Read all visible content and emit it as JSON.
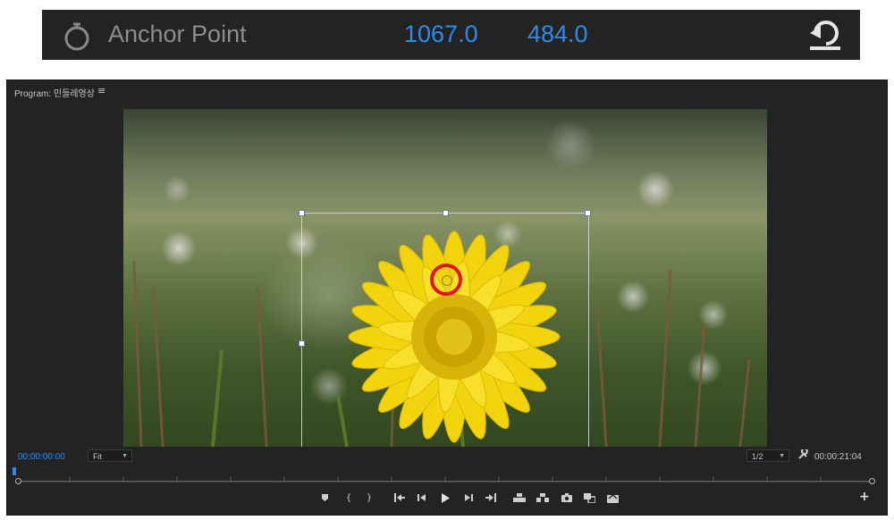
{
  "anchor_point": {
    "label": "Anchor Point",
    "x_value": "1067.0",
    "y_value": "484.0",
    "stopwatch_icon": "stopwatch-icon",
    "reset_icon": "reset-icon",
    "value_color": "#2d8ceb"
  },
  "program_monitor": {
    "title": "Program: 민들레영상",
    "menu_icon": "≡",
    "current_timecode": "00:00:00:00",
    "duration_timecode": "00:00:21:04",
    "zoom_level": "Fit",
    "playback_resolution": "1/2",
    "accent_color": "#2d8ceb",
    "anchor_marker_color": "#e1141c",
    "transport_icons": [
      "add-marker-icon",
      "mark-in-icon",
      "mark-out-icon",
      "go-to-in-icon",
      "step-back-icon",
      "play-icon",
      "step-forward-icon",
      "go-to-out-icon",
      "lift-icon",
      "extract-icon",
      "export-frame-icon",
      "comparison-view-icon",
      "vr-video-icon"
    ],
    "add_button_label": "+"
  }
}
